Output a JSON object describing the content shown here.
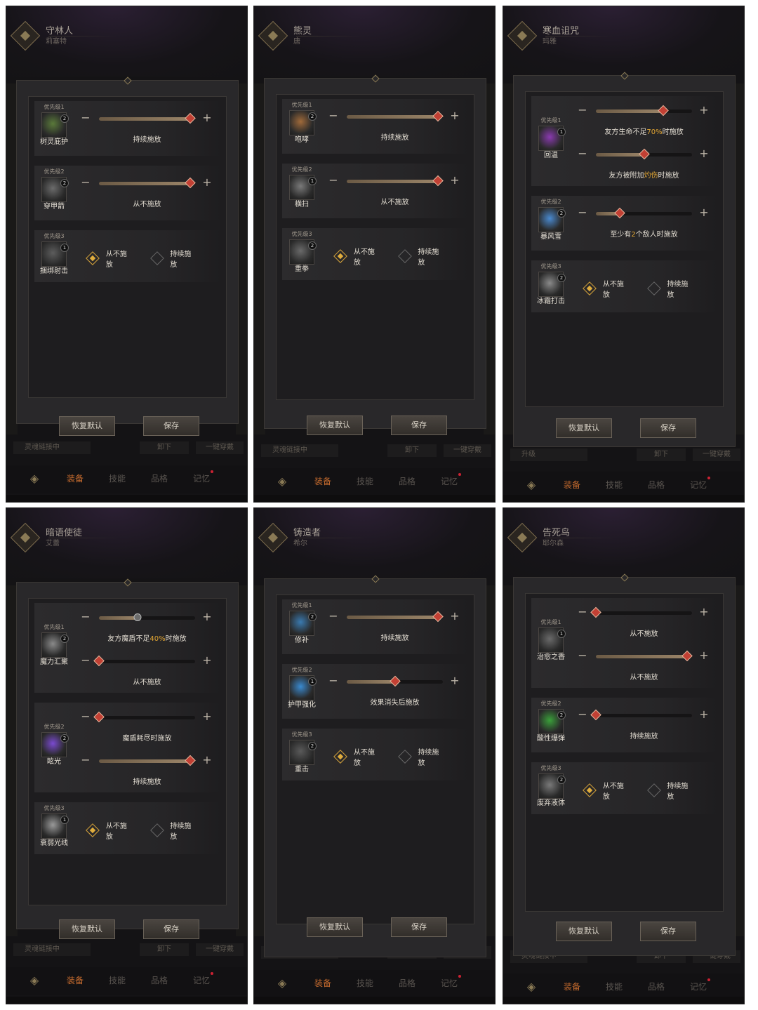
{
  "screens": [
    {
      "hero": {
        "name": "守林人",
        "sub": "莉塞特"
      },
      "skills": [
        {
          "prio": "优先级1",
          "name": "树灵庇护",
          "lvl": "2",
          "color": "#5a7a3a",
          "conds": [
            {
              "text": "持续施放",
              "fill": 0.95
            }
          ]
        },
        {
          "prio": "优先级2",
          "name": "穿甲箭",
          "lvl": "2",
          "color": "#6b6b6b",
          "conds": [
            {
              "text": "从不施放",
              "fill": 0.95
            }
          ]
        },
        {
          "prio": "优先级3",
          "name": "捆绑射击",
          "lvl": "1",
          "color": "#5d5d5d",
          "toggle": {
            "never": "从不施放",
            "always": "持续施放",
            "on": "never"
          }
        }
      ],
      "buttons": {
        "reset": "恢复默认",
        "save": "保存"
      },
      "footer": {
        "left": "灵魂链接中",
        "mid": "卸下",
        "right": "一键穿戴"
      },
      "tabs": [
        "装备",
        "技能",
        "品格",
        "记忆"
      ]
    },
    {
      "hero": {
        "name": "熊灵",
        "sub": "唐"
      },
      "skills": [
        {
          "prio": "优先级1",
          "name": "咆哮",
          "lvl": "2",
          "color": "#a06a3a",
          "conds": [
            {
              "text": "持续施放",
              "fill": 0.95
            }
          ]
        },
        {
          "prio": "优先级2",
          "name": "横扫",
          "lvl": "1",
          "color": "#7a7a7a",
          "conds": [
            {
              "text": "从不施放",
              "fill": 0.95
            }
          ]
        },
        {
          "prio": "优先级3",
          "name": "重拳",
          "lvl": "2",
          "color": "#6a6a6a",
          "toggle": {
            "never": "从不施放",
            "always": "持续施放",
            "on": "never"
          }
        }
      ],
      "buttons": {
        "reset": "恢复默认",
        "save": "保存"
      },
      "footer": {
        "left": "灵魂链接中",
        "mid": "卸下",
        "right": "一键穿戴"
      },
      "tabs": [
        "装备",
        "技能",
        "品格",
        "记忆"
      ]
    },
    {
      "hero": {
        "name": "寒血诅咒",
        "sub": "玛雅"
      },
      "skills": [
        {
          "prio": "优先级1",
          "name": "回温",
          "lvl": "1",
          "color": "#8a3ab0",
          "conds": [
            {
              "pre": "友方生命不足",
              "hl": "70%",
              "post": "时施放",
              "fill": 0.7
            },
            {
              "pre": "友方被附加",
              "hl": "灼伤",
              "post": "时施放",
              "fill": 0.5
            }
          ]
        },
        {
          "prio": "优先级2",
          "name": "暴风雪",
          "lvl": "2",
          "color": "#4a8ad0",
          "conds": [
            {
              "pre": "至少有",
              "hl": "2",
              "post": "个敌人时施放",
              "fill": 0.25
            }
          ]
        },
        {
          "prio": "优先级3",
          "name": "冰霜打击",
          "lvl": "2",
          "color": "#8a8a8a",
          "toggle": {
            "never": "从不施放",
            "always": "持续施放",
            "on": "never"
          }
        }
      ],
      "buttons": {
        "reset": "恢复默认",
        "save": "保存"
      },
      "footer": {
        "left": "升级",
        "mid": "卸下",
        "right": "一键穿戴"
      },
      "tabs": [
        "装备",
        "技能",
        "品格",
        "记忆"
      ]
    },
    {
      "hero": {
        "name": "暗语使徒",
        "sub": "艾蕾"
      },
      "skills": [
        {
          "prio": "优先级1",
          "name": "魔力汇聚",
          "lvl": "2",
          "color": "#8a8a8a",
          "conds": [
            {
              "pre": "友方魔盾不足",
              "hl": "40%",
              "post": "时施放",
              "fill": 0.4,
              "grey": true
            },
            {
              "text": "从不施放",
              "fill": 0.0
            }
          ]
        },
        {
          "prio": "优先级2",
          "name": "眩光",
          "lvl": "2",
          "color": "#7a4ad0",
          "conds": [
            {
              "text": "魔盾耗尽时施放",
              "fill": 0.0
            },
            {
              "text": "持续施放",
              "fill": 0.95
            }
          ]
        },
        {
          "prio": "优先级3",
          "name": "衰弱光线",
          "lvl": "1",
          "color": "#9a9a9a",
          "toggle": {
            "never": "从不施放",
            "always": "持续施放",
            "on": "never"
          }
        }
      ],
      "buttons": {
        "reset": "恢复默认",
        "save": "保存"
      },
      "footer": {
        "left": "灵魂链接中",
        "mid": "卸下",
        "right": "一键穿戴"
      },
      "tabs": [
        "装备",
        "技能",
        "品格",
        "记忆"
      ]
    },
    {
      "hero": {
        "name": "铸造者",
        "sub": "希尔"
      },
      "skills": [
        {
          "prio": "优先级1",
          "name": "修补",
          "lvl": "2",
          "color": "#3a7ab0",
          "conds": [
            {
              "text": "持续施放",
              "fill": 0.95
            }
          ]
        },
        {
          "prio": "优先级2",
          "name": "护甲强化",
          "lvl": "1",
          "color": "#3a8ad0",
          "conds": [
            {
              "text": "效果消失后施放",
              "fill": 0.5
            }
          ]
        },
        {
          "prio": "优先级3",
          "name": "重击",
          "lvl": "2",
          "color": "#5a5a5a",
          "toggle": {
            "never": "从不施放",
            "always": "持续施放",
            "on": "never"
          }
        }
      ],
      "buttons": {
        "reset": "恢复默认",
        "save": "保存"
      },
      "footer": {
        "left": "灵魂链接中",
        "mid": "卸下",
        "right": "一键穿戴"
      },
      "tabs": [
        "装备",
        "技能",
        "品格",
        "记忆"
      ]
    },
    {
      "hero": {
        "name": "告死鸟",
        "sub": "耶尔森"
      },
      "skills": [
        {
          "prio": "优先级1",
          "name": "治愈之香",
          "lvl": "1",
          "color": "#6a6a6a",
          "conds": [
            {
              "text": "从不施放",
              "fill": 0.0
            },
            {
              "text": "从不施放",
              "fill": 0.95
            }
          ]
        },
        {
          "prio": "优先级2",
          "name": "酸性爆弹",
          "lvl": "2",
          "color": "#3aa03a",
          "conds": [
            {
              "text": "持续施放",
              "fill": 0.0
            }
          ]
        },
        {
          "prio": "优先级3",
          "name": "废弃液体",
          "lvl": "2",
          "color": "#7a7a7a",
          "toggle": {
            "never": "从不施放",
            "always": "持续施放",
            "on": "never"
          }
        }
      ],
      "buttons": {
        "reset": "恢复默认",
        "save": "保存"
      },
      "footer": {
        "left": "灵魂链接中",
        "mid": "卸下",
        "right": "一键穿戴"
      },
      "tabs": [
        "装备",
        "技能",
        "品格",
        "记忆"
      ]
    }
  ],
  "colors": {
    "accent": "#e2a633",
    "knob": "#c24034",
    "tab_active": "#c66b2e"
  }
}
